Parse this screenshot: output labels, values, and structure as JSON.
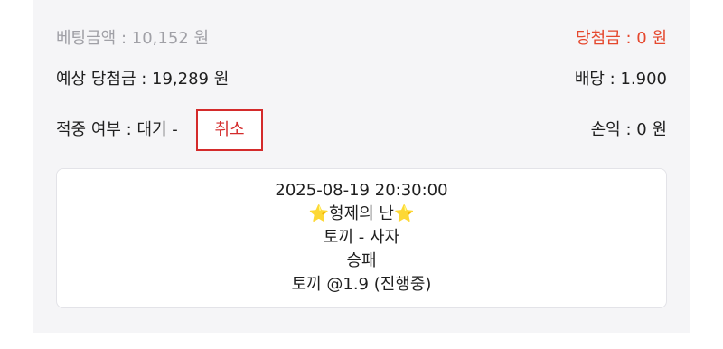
{
  "header_cut": {
    "left_text": "",
    "right_text": ""
  },
  "bet": {
    "bet_amount_label": "베팅금액 : 10,152 원",
    "win_amount_label": "당첨금 : 0 원",
    "expected_win_label": "예상 당첨금 : 19,289 원",
    "odds_label": "배당 : 1.900",
    "hit_status_label": "적중 여부 : 대기 -",
    "cancel_button_label": "취소",
    "profit_label": "손익 : 0 원"
  },
  "detail": {
    "datetime": "2025-08-19 20:30:00",
    "event_name": "형제의 난",
    "star_left": "⭐",
    "star_right": "⭐",
    "matchup": "토끼 - 사자",
    "market": "승패",
    "pick": "토끼 @1.9 (진행중)"
  },
  "colors": {
    "win_amount": "#e5482e",
    "cancel_border": "#d42b2b",
    "card_bg": "#f5f5f7"
  }
}
